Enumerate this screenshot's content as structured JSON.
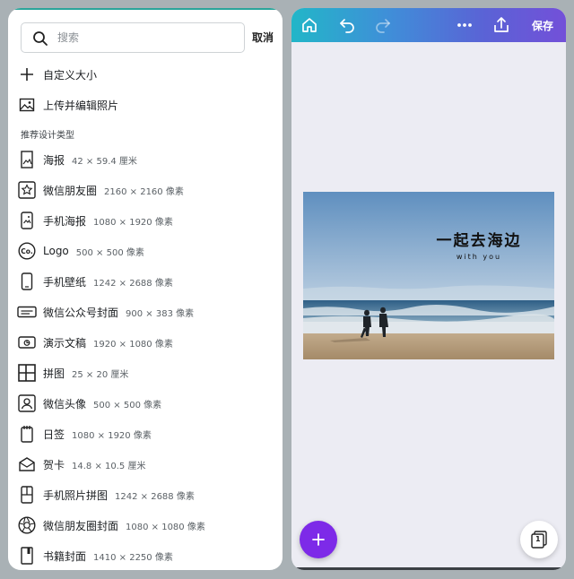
{
  "search": {
    "placeholder": "搜索",
    "cancel_label": "取消"
  },
  "actions": [
    {
      "label": "自定义大小",
      "icon": "plus-icon"
    },
    {
      "label": "上传并编辑照片",
      "icon": "image-upload-icon"
    }
  ],
  "section_title": "推荐设计类型",
  "design_types": [
    {
      "name": "海报",
      "size": "42 × 59.4 厘米",
      "icon": "poster-icon"
    },
    {
      "name": "微信朋友圈",
      "size": "2160 × 2160 像素",
      "icon": "star-frame-icon"
    },
    {
      "name": "手机海报",
      "size": "1080 × 1920 像素",
      "icon": "phone-poster-icon"
    },
    {
      "name": "Logo",
      "size": "500 × 500 像素",
      "icon": "logo-co-icon"
    },
    {
      "name": "手机壁纸",
      "size": "1242 × 2688 像素",
      "icon": "phone-icon"
    },
    {
      "name": "微信公众号封面",
      "size": "900 × 383 像素",
      "icon": "banner-icon"
    },
    {
      "name": "演示文稿",
      "size": "1920 × 1080 像素",
      "icon": "presentation-icon"
    },
    {
      "name": "拼图",
      "size": "25 × 20 厘米",
      "icon": "collage-icon"
    },
    {
      "name": "微信头像",
      "size": "500 × 500 像素",
      "icon": "avatar-frame-icon"
    },
    {
      "name": "日签",
      "size": "1080 × 1920 像素",
      "icon": "calendar-icon"
    },
    {
      "name": "贺卡",
      "size": "14.8 × 10.5 厘米",
      "icon": "envelope-icon"
    },
    {
      "name": "手机照片拼图",
      "size": "1242 × 2688 像素",
      "icon": "phone-collage-icon"
    },
    {
      "name": "微信朋友圈封面",
      "size": "1080 × 1080 像素",
      "icon": "aperture-icon"
    },
    {
      "name": "书籍封面",
      "size": "1410 × 2250 像素",
      "icon": "book-icon"
    }
  ],
  "editor": {
    "save_label": "保存",
    "toolbar_icons": [
      "home-icon",
      "undo-icon",
      "redo-icon",
      "more-icon",
      "share-icon"
    ],
    "canvas_title": "一起去海边",
    "canvas_subtitle": "with you",
    "page_count": "1"
  },
  "colors": {
    "gradient_start": "#22b6c8",
    "gradient_end": "#7350d8",
    "fab": "#7d2ae8"
  }
}
